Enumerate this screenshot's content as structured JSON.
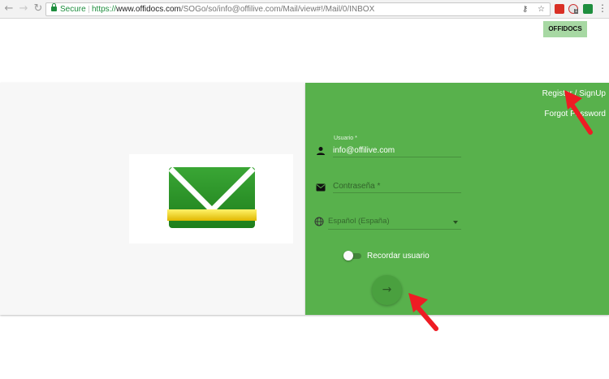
{
  "browser": {
    "secure_label": "Secure",
    "url_scheme": "https://",
    "url_host": "www.offidocs.com",
    "url_path": "/SOGo/so/info@offilive.com/Mail/view#!/Mail/0/INBOX",
    "ext_badge": "1"
  },
  "header": {
    "badge": "OFFIDOCS"
  },
  "login": {
    "register_link": "Register / SignUp",
    "forgot_link": "Forgot Password",
    "username_label": "Usuario *",
    "username_value": "info@offilive.com",
    "password_placeholder": "Contraseña *",
    "language_value": "Español (España)",
    "remember_label": "Recordar usuario",
    "remember_on": false
  },
  "colors": {
    "panel_green": "#58b14c",
    "badge_green": "#a7d8a3",
    "annotation_red": "#ee1c24"
  }
}
